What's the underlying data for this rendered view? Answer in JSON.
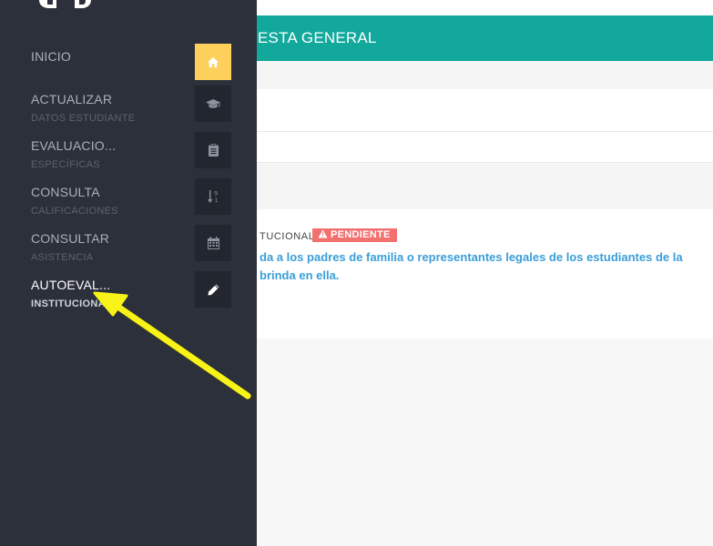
{
  "header": {
    "title": "ESTA GENERAL"
  },
  "card": {
    "label": "TUCIONAL",
    "badge": "PENDIENTE",
    "line1": "da a los padres de familia o representantes legales de los estudiantes de la",
    "line2": "brinda en ella."
  },
  "sidebar": {
    "items": [
      {
        "label": "INICIO",
        "sub": "",
        "icon": "home-icon"
      },
      {
        "label": "ACTUALIZAR",
        "sub": "DATOS ESTUDIANTE",
        "icon": "graduation-cap-icon"
      },
      {
        "label": "EVALUACIO...",
        "sub": "ESPECÍFICAS",
        "icon": "clipboard-icon"
      },
      {
        "label": "CONSULTA",
        "sub": "CALIFICACIONES",
        "icon": "sort-numeric-icon"
      },
      {
        "label": "CONSULTAR",
        "sub": "ASISTENCIA",
        "icon": "calendar-icon"
      },
      {
        "label": "AUTOEVAL...",
        "sub": "INSTITUCIONAL",
        "icon": "pencil-icon"
      }
    ],
    "active_index": 5
  },
  "colors": {
    "sidebar_bg": "#2b303a",
    "icon_box_bg": "#22262e",
    "home_icon_bg": "#fcd05a",
    "header_teal": "#12a99c",
    "badge_red": "#f2716f",
    "link_blue": "#3a9ed8",
    "annotation_arrow": "#f7f318"
  }
}
